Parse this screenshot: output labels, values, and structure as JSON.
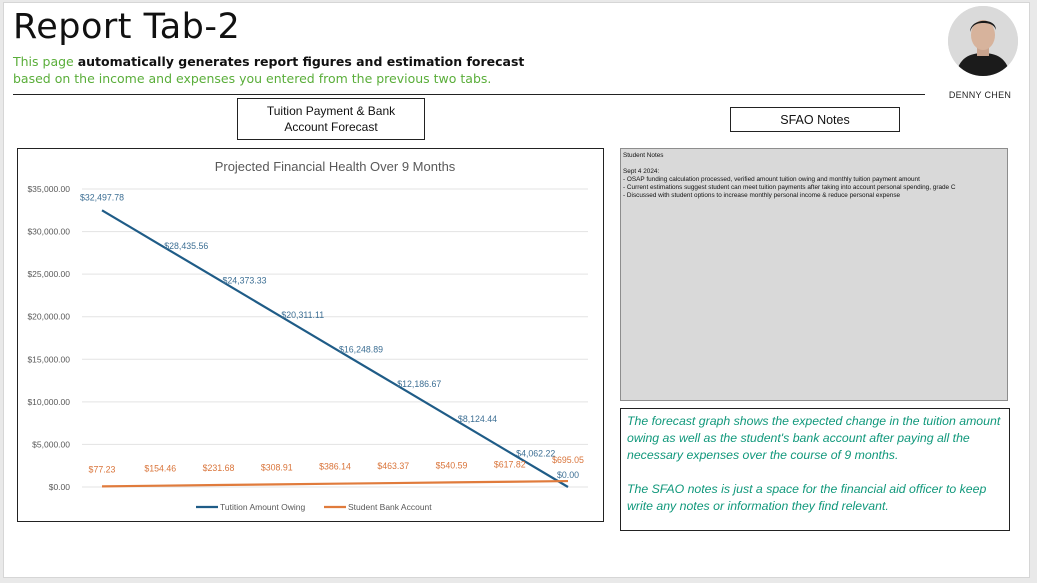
{
  "header": {
    "title": "Report Tab-2",
    "subtitle_pre": "This page ",
    "subtitle_bold": "automatically generates report figures and estimation forecast",
    "subtitle_post": " based on the income and expenses you entered from the previous two tabs."
  },
  "profile": {
    "name": "DENNY CHEN",
    "avatar_icon": "person-avatar-icon"
  },
  "labels": {
    "tuition_forecast": "Tuition Payment & Bank Account Forecast",
    "sfao_notes": "SFAO Notes"
  },
  "notes": {
    "heading": "Student Notes",
    "date": "Sept 4 2024:",
    "items": [
      "- OSAP funding calculation processed, verified amount tuition owing and monthly tuition payment amount",
      "- Current estimations suggest student can meet tuition payments after taking into account personal spending, grade C",
      "- Discussed with student options to increase monthly personal income & reduce personal expense"
    ]
  },
  "info": {
    "para1": "The forecast graph shows the expected change in the tuition amount owing as well as the student's bank account after paying all the necessary expenses over the course of 9 months.",
    "para2": "The SFAO notes is just a space for the financial aid officer to keep write any notes or information they find relevant."
  },
  "chart_data": {
    "type": "line",
    "title": "Projected Financial Health Over 9 Months",
    "xlabel": "",
    "ylabel": "",
    "ylim": [
      0,
      35000
    ],
    "y_ticks": [
      "$0.00",
      "$5,000.00",
      "$10,000.00",
      "$15,000.00",
      "$20,000.00",
      "$25,000.00",
      "$30,000.00",
      "$35,000.00"
    ],
    "x": [
      1,
      2,
      3,
      4,
      5,
      6,
      7,
      8,
      9
    ],
    "grid": true,
    "legend_position": "bottom",
    "series": [
      {
        "name": "Tutition Amount Owing",
        "color": "#1f5c87",
        "values": [
          32497.78,
          28435.56,
          24373.33,
          20311.11,
          16248.89,
          12186.67,
          8124.44,
          4062.22,
          0
        ],
        "labels": [
          "$32,497.78",
          "$28,435.56",
          "$24,373.33",
          "$20,311.11",
          "$16,248.89",
          "$12,186.67",
          "$8,124.44",
          "$4,062.22",
          "$0.00"
        ]
      },
      {
        "name": "Student Bank Account",
        "color": "#e07b3c",
        "values": [
          77.23,
          154.46,
          231.68,
          308.91,
          386.14,
          463.37,
          540.59,
          617.82,
          695.05
        ],
        "labels": [
          "$77.23",
          "$154.46",
          "$231.68",
          "$308.91",
          "$386.14",
          "$463.37",
          "$540.59",
          "$617.82",
          "$695.05"
        ]
      }
    ]
  }
}
